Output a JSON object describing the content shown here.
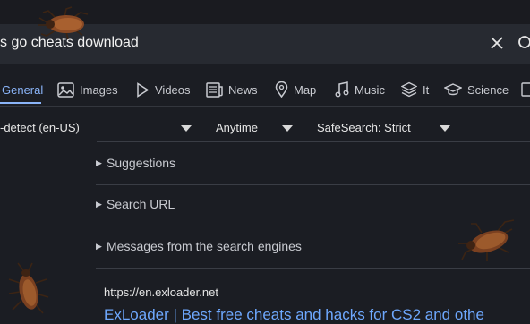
{
  "search": {
    "query": "s go cheats download"
  },
  "tabs": [
    {
      "label": "General",
      "icon": "search-icon",
      "active": true
    },
    {
      "label": "Images",
      "icon": "image-icon"
    },
    {
      "label": "Videos",
      "icon": "play-icon"
    },
    {
      "label": "News",
      "icon": "newspaper-icon"
    },
    {
      "label": "Map",
      "icon": "map-pin-icon"
    },
    {
      "label": "Music",
      "icon": "music-icon"
    },
    {
      "label": "It",
      "icon": "layers-icon"
    },
    {
      "label": "Science",
      "icon": "graduation-cap-icon"
    }
  ],
  "filters": {
    "language": "-detect (en-US)",
    "time": "Anytime",
    "safesearch": "SafeSearch: Strict"
  },
  "sections": {
    "suggestions": "Suggestions",
    "search_url": "Search URL",
    "messages": "Messages from the search engines"
  },
  "result": {
    "url": "https://en.exloader.net",
    "title": "ExLoader | Best free cheats and hacks for CS2 and othe"
  },
  "colors": {
    "accent": "#8ab4f8",
    "link": "#6ea8fe",
    "background": "#1b1d23",
    "searchbar": "#272a31"
  }
}
